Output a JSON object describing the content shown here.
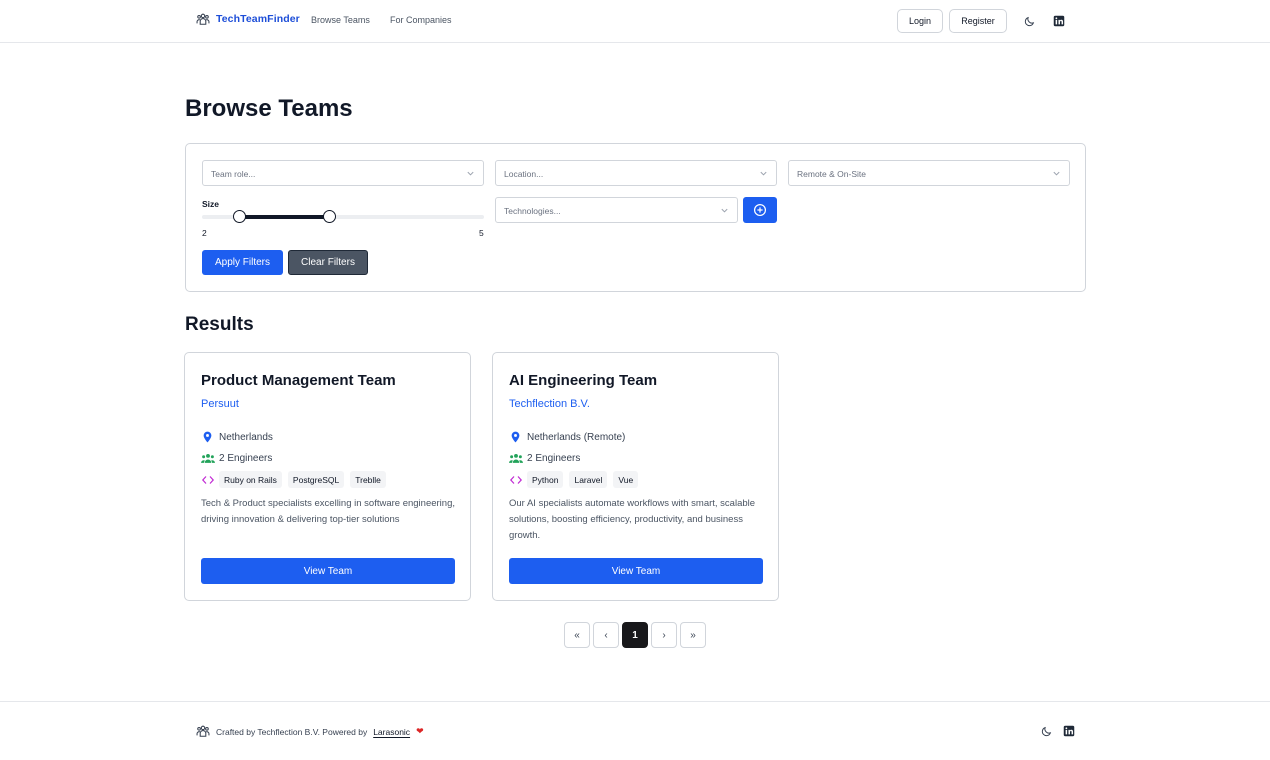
{
  "header": {
    "brand": "TechTeamFinder",
    "nav": [
      {
        "label": "Browse Teams"
      },
      {
        "label": "For Companies"
      }
    ],
    "login_label": "Login",
    "register_label": "Register"
  },
  "page_title": "Browse Teams",
  "filters": {
    "role_placeholder": "Team role...",
    "location_placeholder": "Location...",
    "remote_value": "Remote & On-Site",
    "technologies_placeholder": "Technologies...",
    "size_label": "Size",
    "size_min": "2",
    "size_max": "5",
    "size_range_low_fraction": 0.13,
    "size_range_high_fraction": 0.45,
    "apply_label": "Apply Filters",
    "clear_label": "Clear Filters"
  },
  "results_title": "Results",
  "cards": [
    {
      "title": "Product Management Team",
      "company": "Persuut",
      "location": "Netherlands",
      "engineers": "2 Engineers",
      "tags": [
        "Ruby on Rails",
        "PostgreSQL",
        "Treblle"
      ],
      "description": "Tech & Product specialists excelling in software engineering, driving innovation & delivering top-tier solutions",
      "button": "View Team"
    },
    {
      "title": "AI Engineering Team",
      "company": "Techflection B.V.",
      "location": "Netherlands (Remote)",
      "engineers": "2 Engineers",
      "tags": [
        "Python",
        "Laravel",
        "Vue"
      ],
      "description": "Our AI specialists automate workflows with smart, scalable solutions, boosting efficiency, productivity, and business growth.",
      "button": "View Team"
    }
  ],
  "pagination": {
    "first": "«",
    "prev": "‹",
    "current": "1",
    "next": "›",
    "last": "»"
  },
  "footer": {
    "text": "Crafted by Techflection B.V. Powered by",
    "link": "Larasonic",
    "heart": "❤"
  },
  "colors": {
    "accent": "#1d5ef0",
    "brand": "#1d4ed8",
    "secondary_button": "#4b5563",
    "location_icon": "#1d5ef0",
    "engineers_icon": "#22a35a",
    "code_icon": "#c026d3"
  },
  "icons": {
    "brand": "team-logo-icon",
    "theme": "moon-icon",
    "social": "linkedin-icon",
    "select": "chevron-down-icon",
    "add": "plus-circle-icon",
    "location": "map-pin-icon",
    "engineers": "users-icon",
    "technologies": "code-icon"
  }
}
